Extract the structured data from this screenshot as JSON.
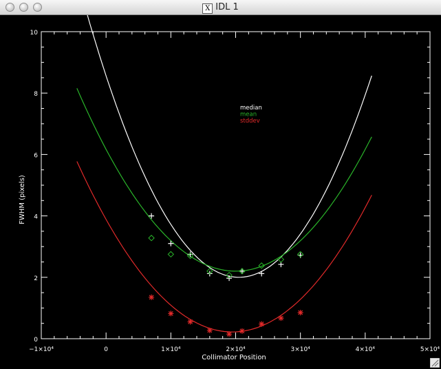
{
  "window": {
    "title": "IDL 1",
    "x_glyph": "X"
  },
  "chart_data": {
    "type": "scatter",
    "xlabel": "Collimator Position",
    "ylabel": "FWHM (pixels)",
    "xlim": [
      -10000,
      50000
    ],
    "ylim": [
      0,
      10
    ],
    "x_ticks": [
      {
        "value": -10000,
        "label": "−1×10⁴"
      },
      {
        "value": 0,
        "label": "0"
      },
      {
        "value": 10000,
        "label": "1×10⁴"
      },
      {
        "value": 20000,
        "label": "2×10⁴"
      },
      {
        "value": 30000,
        "label": "3×10⁴"
      },
      {
        "value": 40000,
        "label": "4×10⁴"
      },
      {
        "value": 50000,
        "label": "5×10⁴"
      }
    ],
    "y_ticks": [
      {
        "value": 0,
        "label": "0"
      },
      {
        "value": 2,
        "label": "2"
      },
      {
        "value": 4,
        "label": "4"
      },
      {
        "value": 6,
        "label": "6"
      },
      {
        "value": 8,
        "label": "8"
      },
      {
        "value": 10,
        "label": "10"
      }
    ],
    "legend_position": "upper-center",
    "grid": false,
    "series": [
      {
        "name": "median",
        "color": "#ffffff",
        "marker": "plus",
        "x": [
          7000,
          10000,
          13000,
          16000,
          19000,
          21000,
          24000,
          27000,
          30000
        ],
        "y": [
          4.0,
          3.1,
          2.75,
          2.12,
          1.97,
          2.2,
          2.12,
          2.42,
          2.72
        ],
        "fit": {
          "a": 0.01562,
          "h": 20500,
          "k": 2.0,
          "x_range": [
            -4500,
            41000
          ]
        }
      },
      {
        "name": "mean",
        "color": "#2ab52a",
        "marker": "diamond",
        "x": [
          7000,
          10000,
          13000,
          16000,
          19000,
          21000,
          24000,
          27000,
          30000
        ],
        "y": [
          3.28,
          2.75,
          2.7,
          2.2,
          2.07,
          2.2,
          2.38,
          2.58,
          2.75
        ],
        "fit": {
          "a": 0.00992,
          "h": 20000,
          "k": 2.2,
          "x_range": [
            -4500,
            41000
          ]
        }
      },
      {
        "name": "stddev",
        "color": "#e22a2a",
        "marker": "asterisk",
        "x": [
          7000,
          10000,
          13000,
          16000,
          19000,
          21000,
          24000,
          27000,
          30000
        ],
        "y": [
          1.35,
          0.82,
          0.55,
          0.27,
          0.15,
          0.25,
          0.48,
          0.67,
          0.85
        ],
        "fit": {
          "a": 0.00964,
          "h": 19500,
          "k": 0.22,
          "x_range": [
            -4500,
            41000
          ]
        }
      }
    ]
  }
}
